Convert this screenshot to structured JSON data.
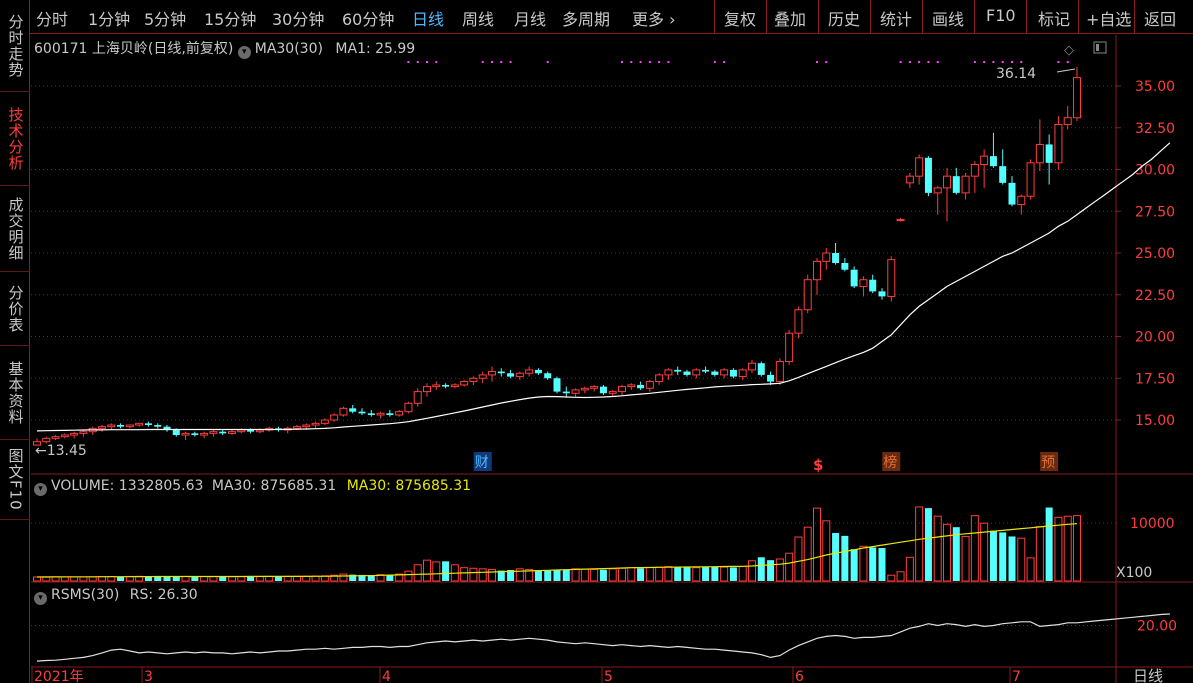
{
  "toolbar": {
    "items": [
      "分时",
      "1分钟",
      "5分钟",
      "15分钟",
      "30分钟",
      "60分钟",
      "日线",
      "周线",
      "月线",
      "多周期",
      "更多 ›"
    ],
    "active": "日线",
    "right_items": [
      "复权",
      "叠加",
      "历史",
      "统计",
      "画线",
      "F10",
      "标记",
      "+自选",
      "返回"
    ]
  },
  "side_tabs": [
    "分时走势",
    "技术分析",
    "成交明细",
    "分价表",
    "基本资料",
    "图文F10"
  ],
  "side_active": "技术分析",
  "main_panel": {
    "stock_code": "600171",
    "stock_name": "上海贝岭",
    "mode": "(日线,前复权)",
    "indicator_label": "MA30(30)",
    "ma1_label": "MA1: 25.99",
    "high_marker": "36.14",
    "low_marker": "13.45",
    "y_ticks": [
      "35.00",
      "32.50",
      "30.00",
      "27.50",
      "25.00",
      "22.50",
      "20.00",
      "17.50",
      "15.00"
    ],
    "events": [
      {
        "label": "财",
        "color": "#4fb8ff"
      },
      {
        "label": "$",
        "color": "#ff3d3d"
      },
      {
        "label": "榜",
        "color": "#e07030"
      },
      {
        "label": "预",
        "color": "#e07030"
      }
    ]
  },
  "volume_panel": {
    "label": "VOLUME: 1332805.63",
    "ma_label": "MA30: 875685.31",
    "ma_label_yellow": "MA30: 875685.31",
    "tick": "10000",
    "unit": "X100"
  },
  "rsms_panel": {
    "label": "RSMS(30)",
    "rs_label": "RS: 26.30",
    "tick": "20.00"
  },
  "x_axis": {
    "labels": [
      "2021年",
      "3",
      "4",
      "5",
      "6",
      "7"
    ],
    "corner": "日线"
  },
  "colors": {
    "up": "#ff3d3d",
    "down": "#54ffff",
    "ma": "#ffffff",
    "vol_ma": "#e8e800",
    "grid": "#8a1c1c",
    "purple": "#ff40ff"
  },
  "chart_data": {
    "type": "candlestick",
    "title": "600171 上海贝岭 (日线,前复权)",
    "ylim": [
      13,
      36.5
    ],
    "periods": [
      "2021年",
      "3",
      "4",
      "5",
      "6",
      "7"
    ],
    "ohlc": [
      [
        13.5,
        13.45,
        13.9,
        13.7
      ],
      [
        13.7,
        13.6,
        14.0,
        13.9
      ],
      [
        13.9,
        13.8,
        14.1,
        14.0
      ],
      [
        14.0,
        13.9,
        14.2,
        14.1
      ],
      [
        14.1,
        13.9,
        14.3,
        14.2
      ],
      [
        14.2,
        14.0,
        14.4,
        14.3
      ],
      [
        14.3,
        14.1,
        14.6,
        14.5
      ],
      [
        14.5,
        14.3,
        14.7,
        14.6
      ],
      [
        14.6,
        14.4,
        14.8,
        14.7
      ],
      [
        14.7,
        14.5,
        14.8,
        14.6
      ],
      [
        14.6,
        14.5,
        14.7,
        14.7
      ],
      [
        14.7,
        14.6,
        14.8,
        14.8
      ],
      [
        14.8,
        14.6,
        14.9,
        14.7
      ],
      [
        14.7,
        14.5,
        14.8,
        14.6
      ],
      [
        14.6,
        14.3,
        14.7,
        14.4
      ],
      [
        14.4,
        14.0,
        14.5,
        14.1
      ],
      [
        14.1,
        13.8,
        14.3,
        14.2
      ],
      [
        14.2,
        14.0,
        14.3,
        14.1
      ],
      [
        14.1,
        13.9,
        14.3,
        14.2
      ],
      [
        14.2,
        14.0,
        14.4,
        14.3
      ],
      [
        14.3,
        14.1,
        14.4,
        14.2
      ],
      [
        14.2,
        14.1,
        14.4,
        14.3
      ],
      [
        14.3,
        14.2,
        14.5,
        14.4
      ],
      [
        14.4,
        14.2,
        14.5,
        14.3
      ],
      [
        14.3,
        14.2,
        14.5,
        14.4
      ],
      [
        14.4,
        14.3,
        14.6,
        14.5
      ],
      [
        14.5,
        14.3,
        14.6,
        14.4
      ],
      [
        14.4,
        14.2,
        14.6,
        14.5
      ],
      [
        14.5,
        14.4,
        14.7,
        14.6
      ],
      [
        14.6,
        14.4,
        14.8,
        14.7
      ],
      [
        14.7,
        14.5,
        14.9,
        14.8
      ],
      [
        14.8,
        14.7,
        15.1,
        15.0
      ],
      [
        15.0,
        14.9,
        15.4,
        15.3
      ],
      [
        15.3,
        15.2,
        15.8,
        15.7
      ],
      [
        15.7,
        15.4,
        15.9,
        15.5
      ],
      [
        15.5,
        15.3,
        15.7,
        15.4
      ],
      [
        15.4,
        15.2,
        15.6,
        15.3
      ],
      [
        15.3,
        15.1,
        15.5,
        15.4
      ],
      [
        15.4,
        15.2,
        15.6,
        15.3
      ],
      [
        15.3,
        15.2,
        15.6,
        15.5
      ],
      [
        15.5,
        15.4,
        16.1,
        16.0
      ],
      [
        16.0,
        15.8,
        16.9,
        16.7
      ],
      [
        16.7,
        16.4,
        17.2,
        17.0
      ],
      [
        17.0,
        16.8,
        17.3,
        17.1
      ],
      [
        17.1,
        16.9,
        17.2,
        17.0
      ],
      [
        17.0,
        16.9,
        17.2,
        17.1
      ],
      [
        17.1,
        17.0,
        17.4,
        17.3
      ],
      [
        17.3,
        17.1,
        17.6,
        17.5
      ],
      [
        17.5,
        17.2,
        17.9,
        17.7
      ],
      [
        17.7,
        17.3,
        18.2,
        17.9
      ],
      [
        17.9,
        17.6,
        18.1,
        17.8
      ],
      [
        17.8,
        17.5,
        18.0,
        17.6
      ],
      [
        17.6,
        17.4,
        17.9,
        17.8
      ],
      [
        17.8,
        17.6,
        18.2,
        18.0
      ],
      [
        18.0,
        17.7,
        18.1,
        17.8
      ],
      [
        17.8,
        17.4,
        17.9,
        17.5
      ],
      [
        17.5,
        16.6,
        17.6,
        16.7
      ],
      [
        16.7,
        16.4,
        17.0,
        16.6
      ],
      [
        16.6,
        16.4,
        16.9,
        16.8
      ],
      [
        16.8,
        16.6,
        17.0,
        16.9
      ],
      [
        16.9,
        16.7,
        17.1,
        17.0
      ],
      [
        17.0,
        16.5,
        17.1,
        16.6
      ],
      [
        16.6,
        16.4,
        16.8,
        16.7
      ],
      [
        16.7,
        16.5,
        17.1,
        17.0
      ],
      [
        17.0,
        16.8,
        17.2,
        17.1
      ],
      [
        17.1,
        16.8,
        17.3,
        16.9
      ],
      [
        16.9,
        16.7,
        17.4,
        17.3
      ],
      [
        17.3,
        17.1,
        17.8,
        17.7
      ],
      [
        17.7,
        17.4,
        18.1,
        18.0
      ],
      [
        18.0,
        17.7,
        18.2,
        17.9
      ],
      [
        17.9,
        17.6,
        18.0,
        17.7
      ],
      [
        17.7,
        17.5,
        18.1,
        18.0
      ],
      [
        18.0,
        17.8,
        18.2,
        17.9
      ],
      [
        17.9,
        17.6,
        18.0,
        17.7
      ],
      [
        17.7,
        17.5,
        18.1,
        18.0
      ],
      [
        18.0,
        17.5,
        18.1,
        17.6
      ],
      [
        17.6,
        17.4,
        18.1,
        18.0
      ],
      [
        18.0,
        17.8,
        18.6,
        18.4
      ],
      [
        18.4,
        17.6,
        18.5,
        17.7
      ],
      [
        17.7,
        17.1,
        17.9,
        17.3
      ],
      [
        17.3,
        17.1,
        18.7,
        18.5
      ],
      [
        18.5,
        18.3,
        20.4,
        20.2
      ],
      [
        20.2,
        19.9,
        21.8,
        21.6
      ],
      [
        21.6,
        21.4,
        23.7,
        23.4
      ],
      [
        23.4,
        22.5,
        24.7,
        24.5
      ],
      [
        24.5,
        24.0,
        25.3,
        25.0
      ],
      [
        25.0,
        24.3,
        25.6,
        24.4
      ],
      [
        24.4,
        23.9,
        24.7,
        24.0
      ],
      [
        24.0,
        22.9,
        24.2,
        23.0
      ],
      [
        23.0,
        22.4,
        23.6,
        23.4
      ],
      [
        23.4,
        22.6,
        23.7,
        22.7
      ],
      [
        22.7,
        22.2,
        22.9,
        22.4
      ],
      [
        22.4,
        22.1,
        24.8,
        24.6
      ],
      [
        27.0,
        26.9,
        27.1,
        27.0
      ],
      [
        29.2,
        28.9,
        29.8,
        29.6
      ],
      [
        29.6,
        29.1,
        30.9,
        30.7
      ],
      [
        30.7,
        28.4,
        30.8,
        28.6
      ],
      [
        28.6,
        27.3,
        29.0,
        28.9
      ],
      [
        28.9,
        26.9,
        30.1,
        29.6
      ],
      [
        29.6,
        28.5,
        30.1,
        28.6
      ],
      [
        28.6,
        28.2,
        29.8,
        29.6
      ],
      [
        29.6,
        28.6,
        30.5,
        30.3
      ],
      [
        30.3,
        28.9,
        31.2,
        30.8
      ],
      [
        30.8,
        30.1,
        32.2,
        30.2
      ],
      [
        30.2,
        29.1,
        31.2,
        29.2
      ],
      [
        29.2,
        27.8,
        29.6,
        27.9
      ],
      [
        27.9,
        27.3,
        28.5,
        28.4
      ],
      [
        28.4,
        28.2,
        30.6,
        30.4
      ],
      [
        30.4,
        29.9,
        33.0,
        31.5
      ],
      [
        31.5,
        29.1,
        32.1,
        30.4
      ],
      [
        30.4,
        30.0,
        33.2,
        32.7
      ],
      [
        32.7,
        32.4,
        33.8,
        33.1
      ],
      [
        33.1,
        32.9,
        36.14,
        35.5
      ]
    ],
    "ma30": [
      14.35,
      14.36,
      14.37,
      14.38,
      14.39,
      14.4,
      14.41,
      14.41,
      14.42,
      14.42,
      14.42,
      14.42,
      14.43,
      14.43,
      14.43,
      14.43,
      14.43,
      14.43,
      14.43,
      14.43,
      14.43,
      14.43,
      14.43,
      14.43,
      14.43,
      14.43,
      14.43,
      14.44,
      14.45,
      14.46,
      14.48,
      14.5,
      14.53,
      14.58,
      14.62,
      14.66,
      14.7,
      14.74,
      14.78,
      14.83,
      14.9,
      15.0,
      15.1,
      15.21,
      15.32,
      15.43,
      15.54,
      15.66,
      15.78,
      15.9,
      16.02,
      16.12,
      16.22,
      16.31,
      16.38,
      16.41,
      16.4,
      16.38,
      16.36,
      16.35,
      16.36,
      16.38,
      16.41,
      16.45,
      16.5,
      16.55,
      16.6,
      16.66,
      16.72,
      16.78,
      16.83,
      16.88,
      16.93,
      16.98,
      17.02,
      17.05,
      17.08,
      17.12,
      17.14,
      17.16,
      17.2,
      17.35,
      17.55,
      17.77,
      17.99,
      18.21,
      18.43,
      18.65,
      18.85,
      19.05,
      19.3,
      19.7,
      20.1,
      20.7,
      21.3,
      21.8,
      22.2,
      22.6,
      23.0,
      23.3,
      23.6,
      23.9,
      24.2,
      24.5,
      24.8,
      25.0,
      25.3,
      25.6,
      25.9,
      26.2,
      26.6,
      26.9,
      27.3,
      27.7,
      28.1,
      28.5,
      28.9,
      29.3,
      29.7,
      30.2,
      30.6,
      31.1,
      31.6
    ],
    "volume": [
      700,
      650,
      720,
      680,
      700,
      690,
      710,
      730,
      760,
      780,
      790,
      810,
      770,
      760,
      820,
      830,
      790,
      800,
      770,
      760,
      740,
      730,
      760,
      780,
      770,
      800,
      790,
      810,
      820,
      840,
      870,
      900,
      1000,
      1200,
      1100,
      1050,
      1000,
      1100,
      1050,
      1200,
      1700,
      2800,
      3600,
      3300,
      3400,
      2800,
      2300,
      2200,
      2100,
      2000,
      1800,
      1900,
      2100,
      2000,
      1900,
      1800,
      1950,
      2000,
      2100,
      2050,
      2000,
      1950,
      2100,
      2200,
      2300,
      2200,
      2350,
      2400,
      2500,
      2450,
      2400,
      2300,
      2450,
      2500,
      2400,
      2350,
      2500,
      3500,
      4100,
      3600,
      3800,
      4800,
      7600,
      9300,
      12600,
      10400,
      8300,
      7800,
      5500,
      6000,
      5800,
      5700,
      1000,
      1600,
      4100,
      12800,
      12600,
      11200,
      9800,
      9300,
      7700,
      11300,
      10000,
      8700,
      8400,
      7700,
      7400,
      4000,
      9400,
      12700,
      11000,
      11200,
      11300
    ],
    "volume_ma30": [
      700,
      710,
      710,
      720,
      720,
      730,
      730,
      740,
      740,
      750,
      750,
      760,
      760,
      770,
      770,
      770,
      770,
      770,
      770,
      770,
      780,
      780,
      780,
      790,
      790,
      790,
      790,
      790,
      800,
      800,
      810,
      820,
      840,
      860,
      880,
      910,
      940,
      980,
      1020,
      1060,
      1100,
      1150,
      1200,
      1250,
      1300,
      1350,
      1400,
      1450,
      1500,
      1550,
      1600,
      1650,
      1700,
      1750,
      1800,
      1850,
      1900,
      1950,
      2000,
      2050,
      2100,
      2150,
      2200,
      2250,
      2300,
      2320,
      2340,
      2360,
      2380,
      2400,
      2420,
      2440,
      2460,
      2480,
      2500,
      2520,
      2540,
      2600,
      2700,
      2800,
      2900,
      3100,
      3400,
      3700,
      4100,
      4500,
      4800,
      5100,
      5400,
      5700,
      5950,
      6200,
      6450,
      6700,
      6950,
      7200,
      7400,
      7600,
      7800,
      8000,
      8150,
      8300,
      8450,
      8600,
      8750,
      8900,
      9050,
      9200,
      9350,
      9500,
      9650,
      9800,
      9900
    ],
    "rs": [
      0.5,
      0.8,
      1.0,
      1.5,
      2.0,
      2.5,
      3.5,
      5.0,
      6.5,
      7.0,
      6.0,
      5.0,
      5.5,
      5.0,
      4.5,
      5.0,
      5.5,
      5.0,
      5.5,
      5.0,
      5.0,
      4.5,
      5.0,
      5.5,
      5.0,
      5.5,
      6.0,
      6.0,
      6.5,
      7.0,
      7.0,
      7.5,
      7.0,
      7.5,
      8.0,
      8.0,
      8.5,
      8.5,
      8.0,
      8.5,
      8.5,
      9.5,
      10.5,
      11.0,
      11.5,
      11.0,
      11.5,
      12.0,
      11.5,
      12.0,
      12.5,
      12.0,
      12.5,
      13.0,
      12.5,
      12.0,
      11.0,
      10.5,
      10.0,
      10.5,
      10.0,
      9.5,
      9.0,
      9.5,
      9.0,
      8.5,
      9.0,
      8.5,
      8.0,
      8.5,
      8.0,
      7.5,
      7.0,
      7.0,
      6.5,
      6.0,
      5.5,
      5.0,
      4.0,
      2.5,
      3.5,
      6.5,
      9.0,
      11.0,
      13.0,
      14.0,
      14.5,
      14.0,
      13.0,
      13.5,
      13.5,
      14.0,
      14.5,
      16.5,
      18.5,
      19.5,
      21.0,
      20.0,
      21.0,
      20.5,
      19.5,
      20.5,
      19.5,
      20.0,
      21.0,
      21.5,
      22.0,
      22.0,
      19.5,
      20.0,
      20.5,
      21.5,
      21.5,
      22.0,
      22.5,
      23.0,
      23.5,
      24.0,
      24.5,
      25.0,
      25.5,
      26.0,
      26.3
    ]
  }
}
